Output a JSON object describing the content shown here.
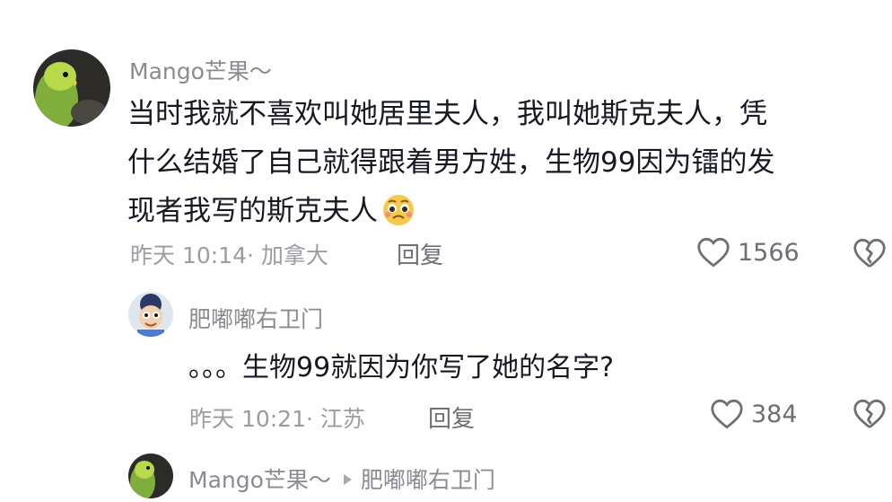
{
  "comments": [
    {
      "username": "Mango芒果～",
      "lines": [
        "当时我就不喜欢叫她居里夫人，我叫她斯克夫人，凭",
        "什么结婚了自己就得跟着男方姓，生物99因为镭的发",
        "现者我写的斯克夫人"
      ],
      "emoji": "pleading-face-emoji",
      "time": "昨天 10:14",
      "location": "加拿大",
      "reply_label": "回复",
      "likes": "1566"
    }
  ],
  "replies": [
    {
      "username": "肥嘟嘟右卫门",
      "text": "。。。生物99就因为你写了她的名字?",
      "time": "昨天 10:21",
      "location": "江苏",
      "reply_label": "回复",
      "likes": "384"
    },
    {
      "username": "Mango芒果～",
      "reply_to": "肥嘟嘟右卫门"
    }
  ]
}
